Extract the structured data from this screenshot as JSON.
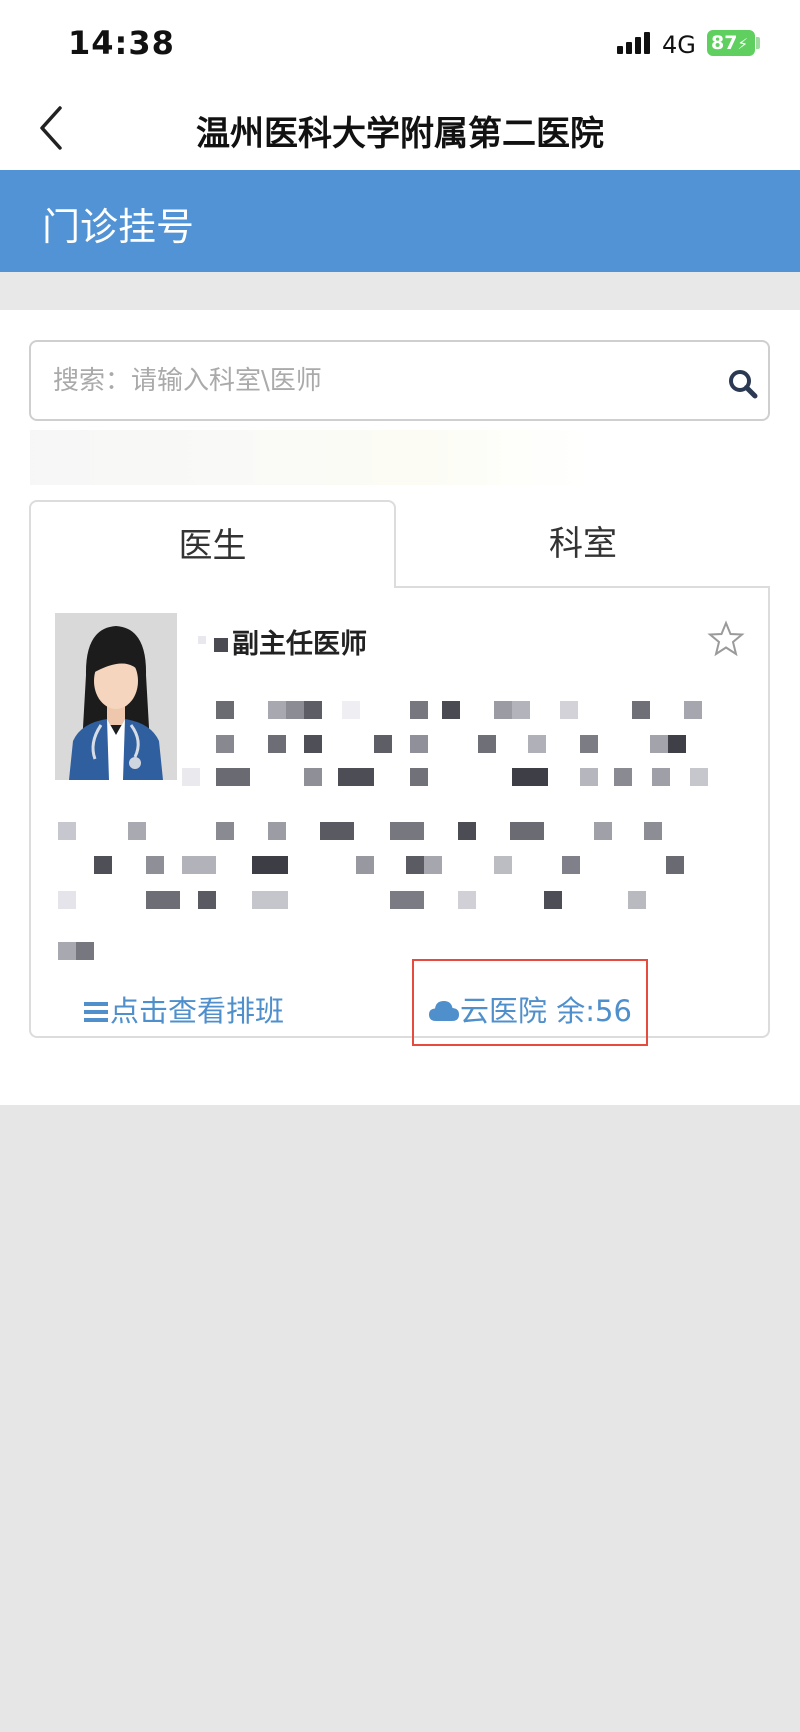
{
  "status_bar": {
    "time": "14:38",
    "network": "4G",
    "battery": "87"
  },
  "nav": {
    "title": "温州医科大学附属第二医院",
    "back_icon": "chevron-left-icon"
  },
  "section": {
    "title": "门诊挂号"
  },
  "search": {
    "placeholder": "搜索：请输入科室\\医师",
    "icon": "search-icon"
  },
  "tabs": [
    {
      "label": "医生",
      "selected": true
    },
    {
      "label": "科室",
      "selected": false
    }
  ],
  "doctor_card": {
    "title": "副主任医师",
    "favorite_icon": "star-outline-icon",
    "schedule_link": "点击查看排班",
    "cloud_hospital": {
      "label": "云医院",
      "remaining": "余:56"
    }
  },
  "colors": {
    "header_blue": "#5193d4",
    "link_blue": "#4e8fcc",
    "highlight_red": "#e54b3f"
  }
}
